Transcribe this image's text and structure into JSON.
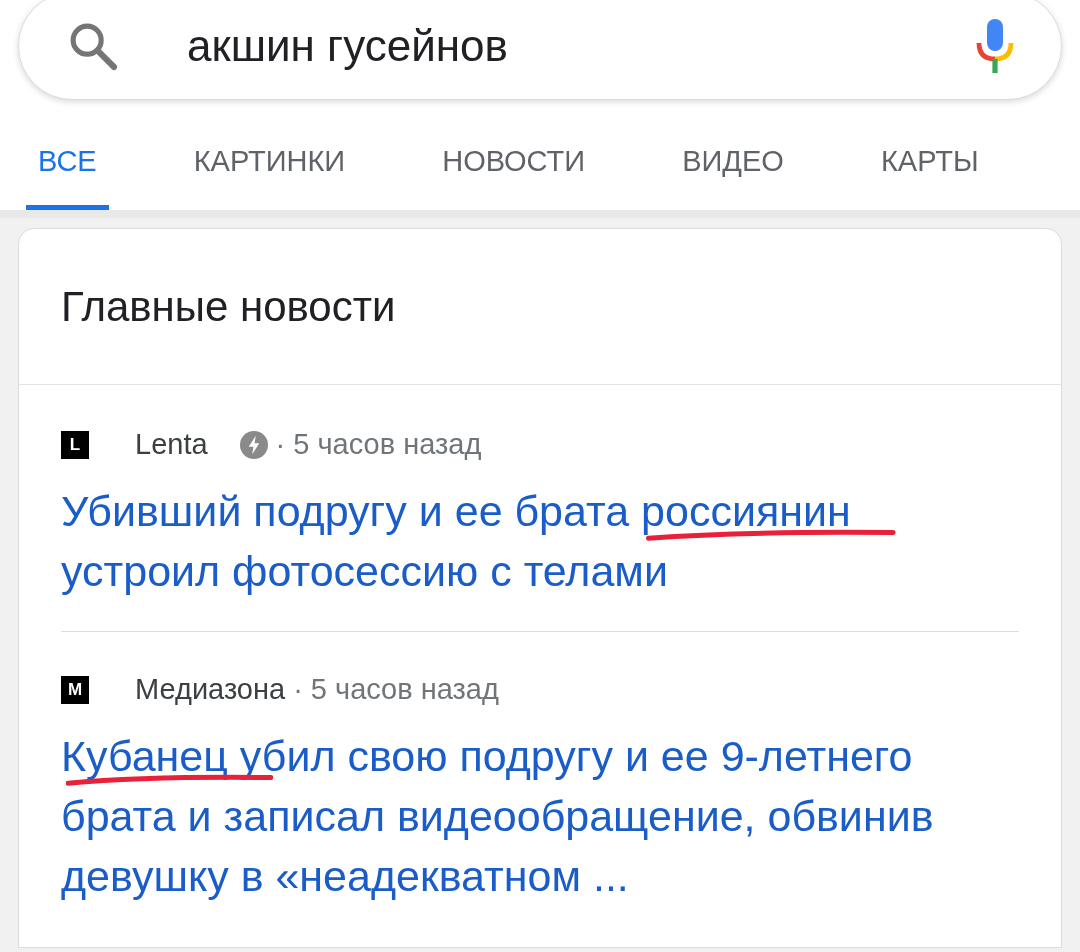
{
  "search": {
    "query": "акшин гусейнов"
  },
  "tabs": [
    {
      "label": "ВСЕ",
      "selected": true
    },
    {
      "label": "КАРТИНКИ",
      "selected": false
    },
    {
      "label": "НОВОСТИ",
      "selected": false
    },
    {
      "label": "ВИДЕО",
      "selected": false
    },
    {
      "label": "КАРТЫ",
      "selected": false
    }
  ],
  "top_stories": {
    "title": "Главные новости",
    "items": [
      {
        "logo_letter": "L",
        "source": "Lenta",
        "amp": true,
        "time": "· 5 часов назад",
        "headline": [
          {
            "text": "Убивший подругу и ее брата ",
            "marked": false
          },
          {
            "text": "россиянин",
            "marked": true
          },
          {
            "text": " устроил фотосессию с телами",
            "marked": false
          }
        ]
      },
      {
        "logo_letter": "M",
        "source": "Медиазона",
        "amp": false,
        "time": "· 5 часов назад",
        "headline": [
          {
            "text": "Кубанец",
            "marked": true
          },
          {
            "text": " убил свою подругу и ее 9-летнего брата и записал видеообращение, обвинив девушку в «неадекватном ...",
            "marked": false
          }
        ]
      }
    ]
  }
}
